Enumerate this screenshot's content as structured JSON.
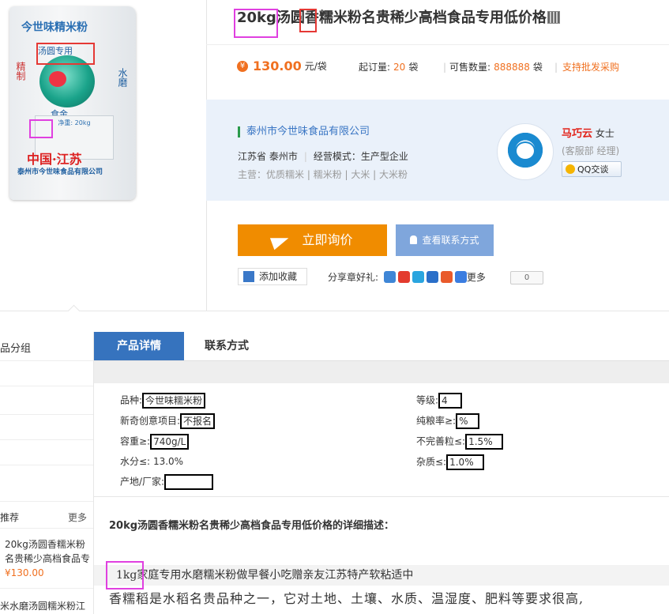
{
  "product": {
    "title": "20kg汤圆香糯米粉名贵稀少高档食品专用低价格",
    "price_symbol": "¥",
    "price": "130.00",
    "price_unit": "元/袋",
    "min_order_label": "起订量:",
    "min_order_value": "20",
    "min_order_unit": "袋",
    "available_label": "可售数量:",
    "available_value": "888888",
    "available_unit": "袋",
    "wholesale_link": "支持批发采购"
  },
  "bag_image": {
    "brand": "今世味精米粉",
    "sub": "汤圆专用",
    "left_vert": "精制",
    "right_vert": "水磨",
    "center": "食金",
    "origin": "中国·江苏",
    "company": "泰州市今世味食品有限公司",
    "net_weight": "净重: 20kg"
  },
  "company": {
    "name": "泰州市今世味食品有限公司",
    "location": "江苏省 泰州市",
    "mode_label": "经营模式：",
    "mode_value": "生产型企业",
    "main_label": "主营：",
    "main_items": "优质糯米 | 糯米粉 | 大米 | 大米粉",
    "contact_name": "马巧云",
    "contact_gender": "女士",
    "contact_role": "(客服部 经理)",
    "qq_button": "QQ交谈"
  },
  "actions": {
    "inquiry": "立即询价",
    "view_contact": "查看联系方式",
    "favorite": "添加收藏",
    "share_label": "分享章好礼:",
    "share_more": "更多",
    "share_count": "0"
  },
  "sidebar": {
    "group_header": "品分组",
    "recommend_label": "推荐",
    "more": "更多",
    "item1_title": "20kg汤圆香糯米粉名贵稀少高档食品专",
    "item1_price": "¥130.00",
    "item2_title": "米水磨汤圆糯米粉江"
  },
  "tabs": {
    "active": "产品详情",
    "second": "联系方式"
  },
  "attributes": {
    "variety_label": "品种:",
    "variety_value": "今世味糯米粉",
    "innovation_label": "新奇创意项目:",
    "innovation_value": "不报名",
    "bulk_label": "容重≥:",
    "bulk_value": "740g/L",
    "moisture_label": "水分≤:",
    "moisture_value": "13.0%",
    "origin_label": "产地/厂家:",
    "origin_value": "",
    "grade_label": "等级:",
    "grade_value": "4",
    "purity_label": "纯粮率≥:",
    "purity_value": "%",
    "imperfect_label": "不完善粒≤:",
    "imperfect_value": "1.5%",
    "impurity_label": "杂质≤:",
    "impurity_value": "1.0%"
  },
  "description": {
    "heading": "20kg汤圆香糯米粉名贵稀少高档食品专用低价格的详细描述：",
    "line1": "1kg家庭专用水磨糯米粉做早餐小吃赠亲友江苏特产软粘适中",
    "line2": "香糯稻是水稻名贵品种之一，它对土地、土壤、水质、温湿度、肥料等要求很高,"
  },
  "colors": {
    "accent_orange": "#f07020",
    "inquiry_button": "#f08c00",
    "tab_blue": "#3673be",
    "company_box": "#eaf1fa"
  }
}
